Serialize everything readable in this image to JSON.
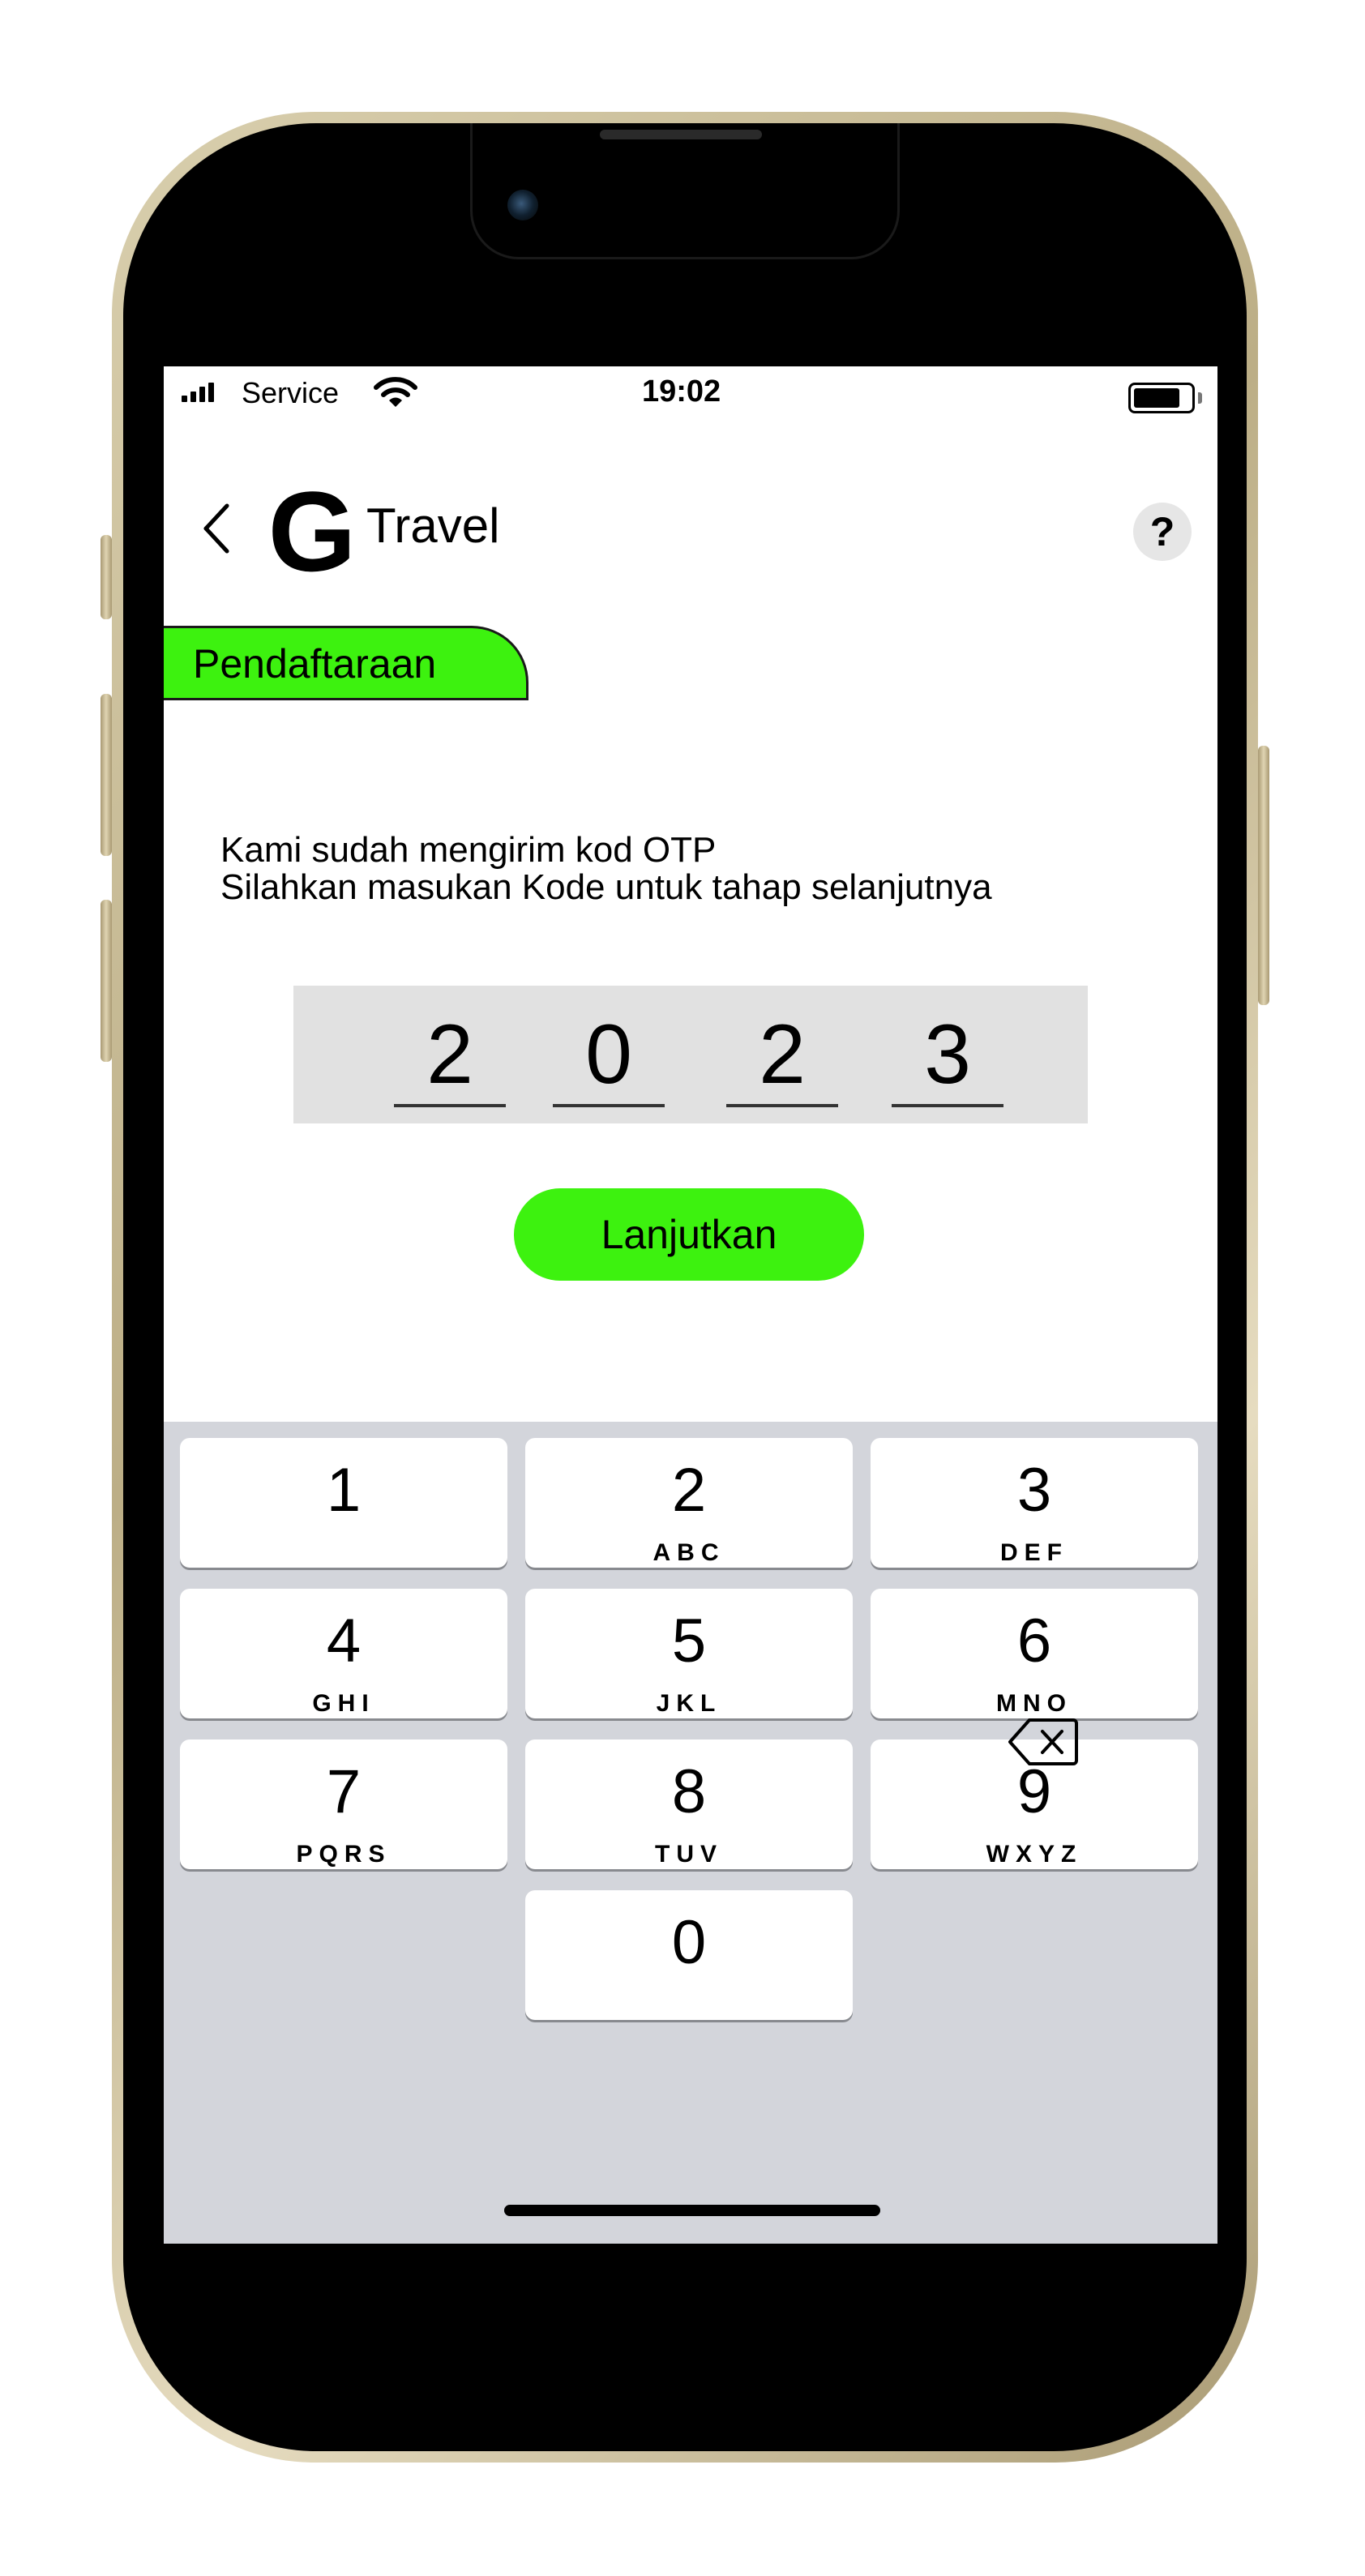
{
  "status_bar": {
    "carrier": "Service",
    "time": "19:02",
    "battery_level": 0.82
  },
  "header": {
    "logo_letter": "G",
    "brand": "Travel",
    "help_label": "?"
  },
  "tab": {
    "label": "Pendaftaraan"
  },
  "message": {
    "line1": "Kami sudah mengirim kod OTP",
    "line2": "Silahkan masukan Kode untuk tahap selanjutnya"
  },
  "otp": {
    "digits": [
      "2",
      "0",
      "2",
      "3"
    ]
  },
  "actions": {
    "continue_label": "Lanjutkan"
  },
  "keypad": {
    "keys": [
      {
        "num": "1",
        "letters": ""
      },
      {
        "num": "2",
        "letters": "ABC"
      },
      {
        "num": "3",
        "letters": "DEF"
      },
      {
        "num": "4",
        "letters": "GHI"
      },
      {
        "num": "5",
        "letters": "JKL"
      },
      {
        "num": "6",
        "letters": "MNO"
      },
      {
        "num": "7",
        "letters": "PQRS"
      },
      {
        "num": "8",
        "letters": "TUV"
      },
      {
        "num": "9",
        "letters": "WXYZ"
      },
      {
        "num": "0",
        "letters": ""
      }
    ]
  },
  "colors": {
    "accent": "#3df20f",
    "keypad_bg": "#d3d5db",
    "otp_bg": "#e1e1e1"
  },
  "icons": [
    "back-chevron-icon",
    "cellular-signal-icon",
    "wifi-icon",
    "battery-icon",
    "help-icon",
    "delete-icon"
  ]
}
